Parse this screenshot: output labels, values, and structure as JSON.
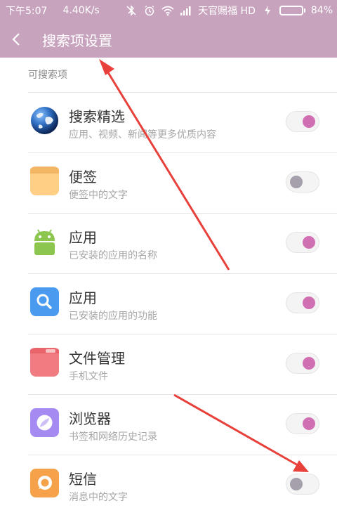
{
  "status_bar": {
    "time": "下午5:07",
    "speed": "4.40K/s",
    "carrier": "天官赐福 HD",
    "battery": "84%",
    "battery_level": 0.84
  },
  "header": {
    "title": "搜索项设置"
  },
  "section": {
    "label": "可搜索项"
  },
  "items": [
    {
      "title": "搜索精选",
      "subtitle": "应用、视频、新闻等更多优质内容",
      "enabled": true,
      "icon": "globe-icon"
    },
    {
      "title": "便签",
      "subtitle": "便签中的文字",
      "enabled": false,
      "icon": "notes-icon"
    },
    {
      "title": "应用",
      "subtitle": "已安装的应用的名称",
      "enabled": true,
      "icon": "android-icon"
    },
    {
      "title": "应用",
      "subtitle": "已安装的应用的功能",
      "enabled": true,
      "icon": "search-icon"
    },
    {
      "title": "文件管理",
      "subtitle": "手机文件",
      "enabled": true,
      "icon": "folder-icon"
    },
    {
      "title": "浏览器",
      "subtitle": "书签和网络历史记录",
      "enabled": true,
      "icon": "browser-icon"
    },
    {
      "title": "短信",
      "subtitle": "消息中的文字",
      "enabled": false,
      "icon": "message-icon"
    }
  ],
  "colors": {
    "accent": "#c8a3be",
    "toggle_on": "#d16fb3",
    "toggle_off": "#a6a0ac",
    "arrow": "#e8413c"
  }
}
